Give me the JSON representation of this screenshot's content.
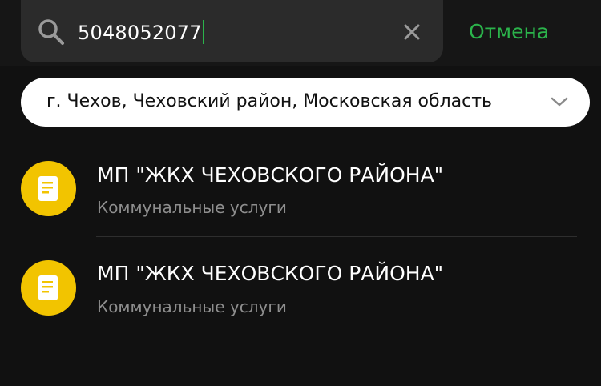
{
  "search": {
    "value": "5048052077",
    "cancel_label": "Отмена",
    "icon": "search-icon",
    "clear_icon": "close-icon"
  },
  "region": {
    "value": "г. Чехов, Чеховский район, Московская область",
    "icon": "chevron-down-icon"
  },
  "results": [
    {
      "title": "МП \"ЖКХ ЧЕХОВСКОГО РАЙОНА\"",
      "subtitle": "Коммунальные услуги",
      "icon": "document-icon"
    },
    {
      "title": "МП \"ЖКХ ЧЕХОВСКОГО РАЙОНА\"",
      "subtitle": "Коммунальные услуги",
      "icon": "document-icon"
    }
  ],
  "colors": {
    "accent": "#2bb34b",
    "avatar": "#f2c400",
    "background": "#111111",
    "search_field": "#2b2b2b"
  }
}
